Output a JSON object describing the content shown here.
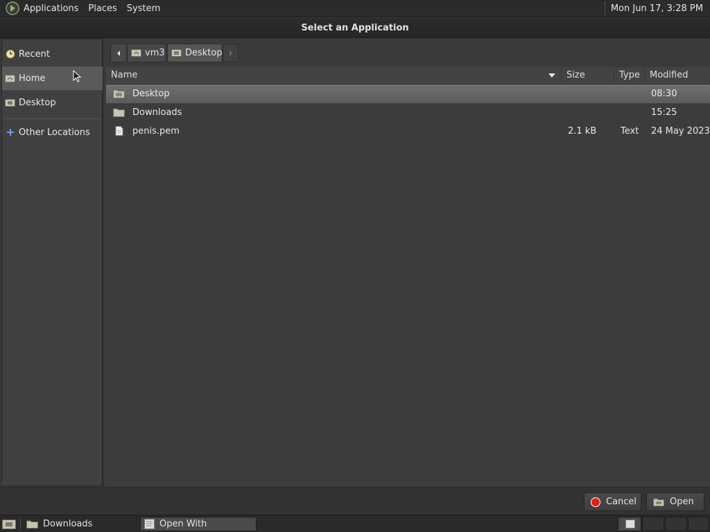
{
  "top_panel": {
    "menus": [
      "Applications",
      "Places",
      "System"
    ],
    "clock": "Mon Jun 17,  3:28 PM"
  },
  "window": {
    "title": "Select an Application"
  },
  "sidebar": {
    "items": [
      {
        "label": "Recent",
        "icon": "recent-icon"
      },
      {
        "label": "Home",
        "icon": "home-folder-icon",
        "selected": true
      },
      {
        "label": "Desktop",
        "icon": "desktop-folder-icon"
      },
      {
        "label": "Other Locations",
        "icon": "other-locations-icon"
      }
    ]
  },
  "pathbar": {
    "crumbs": [
      "vm3",
      "Desktop"
    ]
  },
  "columns": {
    "name": "Name",
    "size": "Size",
    "type": "Type",
    "modified": "Modified"
  },
  "files": [
    {
      "name": "Desktop",
      "size": "",
      "type": "",
      "modified": "08:30",
      "icon": "folder-icon",
      "selected": true
    },
    {
      "name": "Downloads",
      "size": "",
      "type": "",
      "modified": "15:25",
      "icon": "folder-icon"
    },
    {
      "name": "penis.pem",
      "size": "2.1 kB",
      "type": "Text",
      "modified": "24 May 2023",
      "icon": "text-file-icon"
    }
  ],
  "buttons": {
    "cancel": "Cancel",
    "open": "Open"
  },
  "taskbar": {
    "tasks": [
      "Downloads",
      "Open With"
    ]
  },
  "colors": {
    "accent_cancel": "#e0201a",
    "selection": "#686868"
  }
}
